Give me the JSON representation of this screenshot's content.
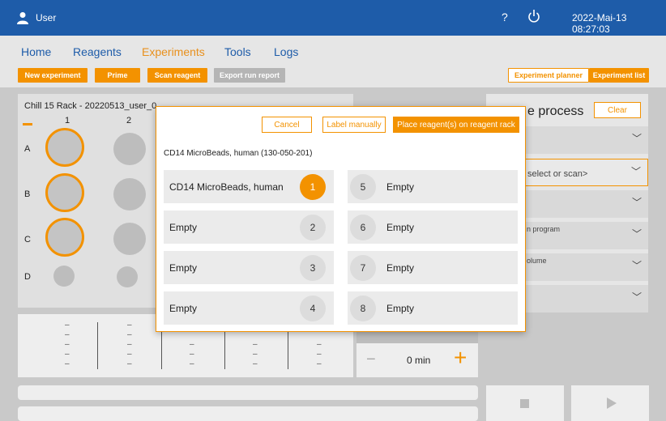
{
  "header": {
    "user_label": "User",
    "help_glyph": "?",
    "datetime": "2022-Mai-13   08:27:03"
  },
  "nav": {
    "items": [
      "Home",
      "Reagents",
      "Experiments",
      "Tools",
      "Logs"
    ],
    "active": "Experiments"
  },
  "toolbar": {
    "new_experiment": "New experiment",
    "prime": "Prime",
    "scan_reagent": "Scan reagent",
    "export_run_report": "Export run report",
    "experiment_planner": "Experiment planner",
    "experiment_list": "Experiment list"
  },
  "rack": {
    "title": "Chill 15 Rack - 20220513_user_0",
    "columns": [
      "1",
      "2"
    ],
    "rows": [
      "A",
      "B",
      "C",
      "D"
    ]
  },
  "timer": {
    "value": "0 min",
    "minus": "−",
    "plus": "+"
  },
  "right_panel": {
    "title": "e process",
    "clear_label": "Clear",
    "select_hint": "select or scan>",
    "program_label": "n program",
    "volume_label": "olume"
  },
  "modal": {
    "cancel": "Cancel",
    "label_manually": "Label manually",
    "place_reagents": "Place reagent(s) on reagent rack",
    "reagent_title": "CD14 MicroBeads, human (130-050-201)",
    "slots": [
      {
        "number": "1",
        "name": "CD14 MicroBeads, human"
      },
      {
        "number": "2",
        "name": "Empty"
      },
      {
        "number": "3",
        "name": "Empty"
      },
      {
        "number": "4",
        "name": "Empty"
      },
      {
        "number": "5",
        "name": "Empty"
      },
      {
        "number": "6",
        "name": "Empty"
      },
      {
        "number": "7",
        "name": "Empty"
      },
      {
        "number": "8",
        "name": "Empty"
      }
    ],
    "selected_slot": "1"
  },
  "colors": {
    "header_blue": "#1e5ca9",
    "accent_orange": "#f39200",
    "disabled_gray": "#b5b5b5"
  }
}
